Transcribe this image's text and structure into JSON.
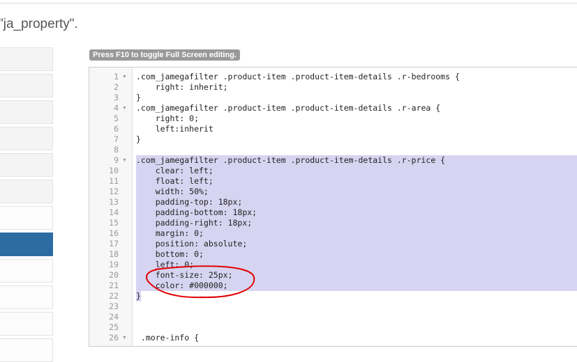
{
  "page": {
    "title": "\"ja_property\"."
  },
  "left_panel": {
    "items": [
      "",
      "",
      "",
      "",
      "",
      "",
      "",
      "",
      "",
      "",
      "",
      ""
    ],
    "active_index": 7
  },
  "editor": {
    "hint": "Press F10 to toggle Full Screen editing.",
    "lines": [
      {
        "n": "1",
        "fold": true,
        "text": ".com_jamegafilter .product-item .product-item-details .r-bedrooms {"
      },
      {
        "n": "2",
        "text": "    right: inherit;"
      },
      {
        "n": "3",
        "text": "}"
      },
      {
        "n": "4",
        "fold": true,
        "text": ".com_jamegafilter .product-item .product-item-details .r-area {"
      },
      {
        "n": "5",
        "text": "    right: 0;"
      },
      {
        "n": "6",
        "text": "    left:inherit"
      },
      {
        "n": "7",
        "text": "}"
      },
      {
        "n": "8",
        "text": ""
      },
      {
        "n": "9",
        "fold": true,
        "sel": true,
        "text": ".com_jamegafilter .product-item .product-item-details .r-price {"
      },
      {
        "n": "10",
        "sel": true,
        "text": "    clear: left;"
      },
      {
        "n": "11",
        "sel": true,
        "text": "    float: left;"
      },
      {
        "n": "12",
        "sel": true,
        "text": "    width: 50%;"
      },
      {
        "n": "13",
        "sel": true,
        "text": "    padding-top: 18px;"
      },
      {
        "n": "14",
        "sel": true,
        "text": "    padding-bottom: 18px;"
      },
      {
        "n": "15",
        "sel": true,
        "text": "    padding-right: 18px;"
      },
      {
        "n": "16",
        "sel": true,
        "text": "    margin: 0;"
      },
      {
        "n": "17",
        "sel": true,
        "text": "    position: absolute;"
      },
      {
        "n": "18",
        "sel": true,
        "text": "    bottom: 0;"
      },
      {
        "n": "19",
        "sel": true,
        "text": "    left: 0;"
      },
      {
        "n": "20",
        "sel": true,
        "text": "    font-size: 25px;"
      },
      {
        "n": "21",
        "sel": true,
        "text": "    color: #000000;"
      },
      {
        "n": "22",
        "selpart": true,
        "text": "}"
      },
      {
        "n": "23",
        "text": ""
      },
      {
        "n": "24",
        "text": ""
      },
      {
        "n": "25",
        "text": ""
      },
      {
        "n": "26",
        "fold": true,
        "text": " .more-info {"
      }
    ]
  },
  "colors": {
    "active": "#2d6ca2",
    "selection": "#d6d4f0",
    "annotation": "#e00000"
  }
}
